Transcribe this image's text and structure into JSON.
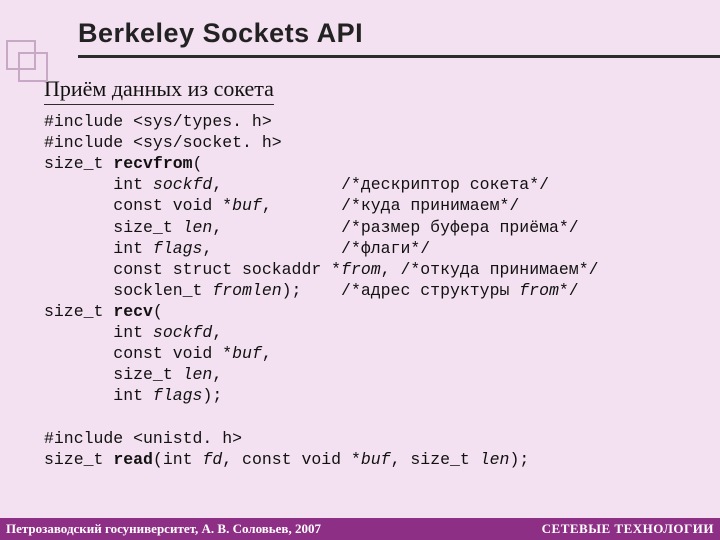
{
  "title": "Berkeley Sockets API",
  "subtitle": "Приём данных из сокета",
  "code": {
    "l1": "#include <sys/types. h>",
    "l2": "#include <sys/socket. h>",
    "l3a": "size_t ",
    "l3b": "recvfrom",
    "l3c": "(",
    "l4a": "       int ",
    "l4b": "sockfd",
    "l4c": ",            /*дескриптор сокета*/",
    "l5a": "       const void *",
    "l5b": "buf",
    "l5c": ",       /*куда принимаем*/",
    "l6a": "       size_t ",
    "l6b": "len",
    "l6c": ",            /*размер буфера приёма*/",
    "l7a": "       int ",
    "l7b": "flags",
    "l7c": ",             /*флаги*/",
    "l8a": "       const struct sockaddr *",
    "l8b": "from",
    "l8c": ", /*откуда принимаем*/",
    "l9a": "       socklen_t ",
    "l9b": "fromlen",
    "l9c": ");    /*адрес структуры ",
    "l9d": "from",
    "l9e": "*/",
    "l10a": "size_t ",
    "l10b": "recv",
    "l10c": "(",
    "l11a": "       int ",
    "l11b": "sockfd",
    "l11c": ",",
    "l12a": "       const void *",
    "l12b": "buf",
    "l12c": ",",
    "l13a": "       size_t ",
    "l13b": "len",
    "l13c": ",",
    "l14a": "       int ",
    "l14b": "flags",
    "l14c": ");",
    "l15": "#include <unistd. h>",
    "l16a": "size_t ",
    "l16b": "read",
    "l16c": "(int ",
    "l16d": "fd",
    "l16e": ", const void *",
    "l16f": "buf",
    "l16g": ", size_t ",
    "l16h": "len",
    "l16i": ");"
  },
  "footer": {
    "left": "Петрозаводский госуниверситет, А. В. Соловьев, 2007",
    "right": "СЕТЕВЫЕ ТЕХНОЛОГИИ"
  }
}
